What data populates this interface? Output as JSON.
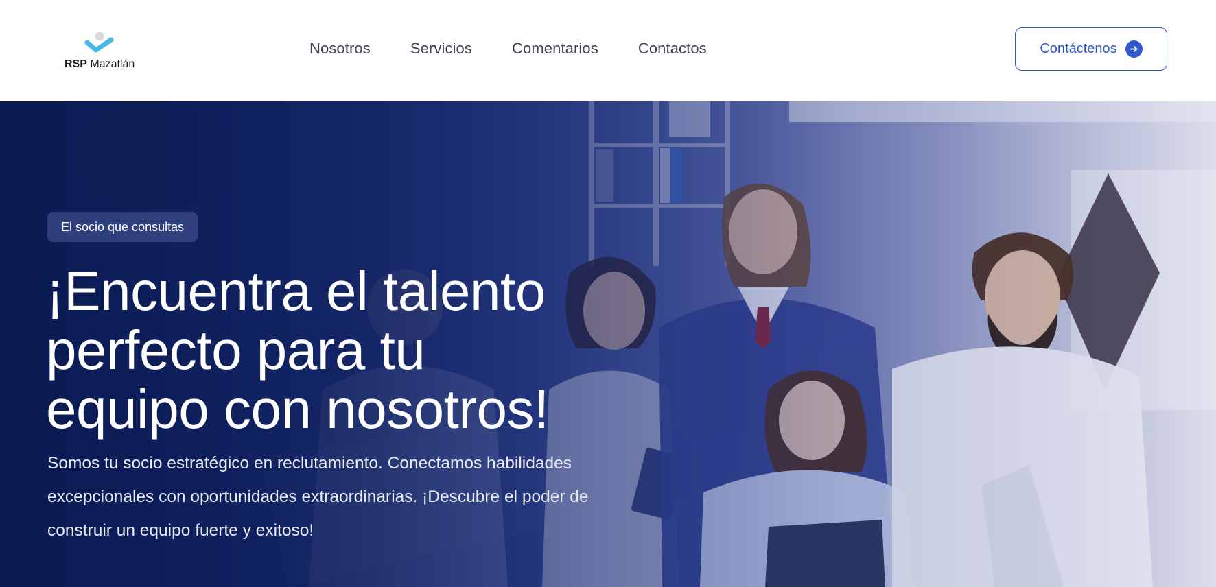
{
  "header": {
    "logo": {
      "brand": "RSP",
      "name": "Mazatlán",
      "icon": "check-person-logo-icon"
    },
    "nav": [
      {
        "label": "Nosotros"
      },
      {
        "label": "Servicios"
      },
      {
        "label": "Comentarios"
      },
      {
        "label": "Contactos"
      }
    ],
    "cta": {
      "label": "Contáctenos",
      "icon": "arrow-right-circle-icon"
    }
  },
  "hero": {
    "badge": "El socio que consultas",
    "title_lines": [
      "¡Encuentra el talento",
      "perfecto para tu",
      "equipo con nosotros!"
    ],
    "description_lines": [
      "Somos tu socio estratégico en reclutamiento. Conectamos habilidades",
      "excepcionales con oportunidades extraordinarias. ¡Descubre el poder de",
      "construir un equipo fuerte y exitoso!"
    ],
    "background_image": "team-of-smiling-professionals-photo"
  },
  "colors": {
    "accent": "#2f58cd",
    "hero_dark": "#0c1c54",
    "nav_text": "#3f4250",
    "logo_light_blue": "#48b8e8",
    "logo_gray": "#d6d9de"
  }
}
